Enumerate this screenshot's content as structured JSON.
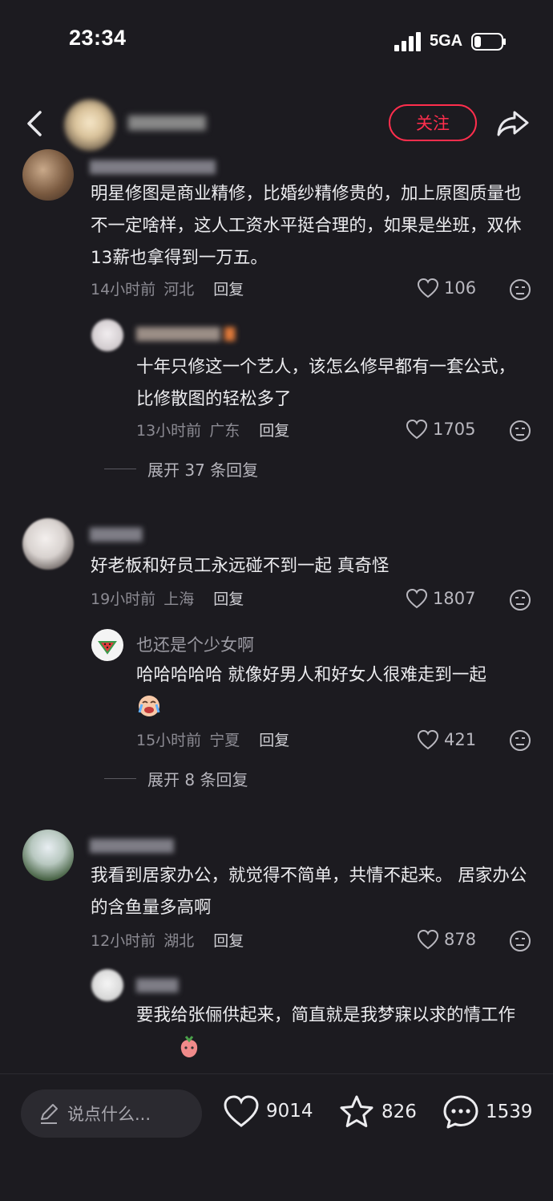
{
  "status_bar": {
    "time": "23:34",
    "network": "5GA"
  },
  "header": {
    "follow_label": "关注"
  },
  "comments": [
    {
      "text": "明星修图是商业精修，比婚纱精修贵的，加上原图质量也不一定啥样，这人工资水平挺合理的，如果是坐班，双休13薪也拿得到一万五。",
      "time": "14小时前",
      "location": "河北",
      "reply_label": "回复",
      "likes": "106",
      "replies": [
        {
          "text": "十年只修这一个艺人，该怎么修早都有一套公式，比修散图的轻松多了",
          "time": "13小时前",
          "location": "广东",
          "reply_label": "回复",
          "likes": "1705"
        }
      ],
      "expand_label": "展开 37 条回复"
    },
    {
      "text": "好老板和好员工永远碰不到一起 真奇怪",
      "time": "19小时前",
      "location": "上海",
      "reply_label": "回复",
      "likes": "1807",
      "replies": [
        {
          "name": "也还是个少女啊",
          "text": "哈哈哈哈哈 就像好男人和好女人很难走到一起",
          "time": "15小时前",
          "location": "宁夏",
          "reply_label": "回复",
          "likes": "421"
        }
      ],
      "expand_label": "展开 8 条回复"
    },
    {
      "text": "我看到居家办公，就觉得不简单，共情不起来。 居家办公的含鱼量多高啊",
      "time": "12小时前",
      "location": "湖北",
      "reply_label": "回复",
      "likes": "878",
      "replies": [
        {
          "text": "要我给张俪供起来，简直就是我梦寐以求的情工作"
        }
      ]
    }
  ],
  "bottom_bar": {
    "input_placeholder": "说点什么...",
    "likes": "9014",
    "favorites": "826",
    "comments": "1539"
  },
  "colors": {
    "background": "#1c1b20",
    "accent": "#ff2e4d"
  },
  "icons": [
    "back-icon",
    "share-icon",
    "heart-icon",
    "dislike-icon",
    "pencil-icon",
    "star-icon",
    "comment-icon",
    "crying-emoji-icon",
    "fruit-emoji-icon"
  ]
}
